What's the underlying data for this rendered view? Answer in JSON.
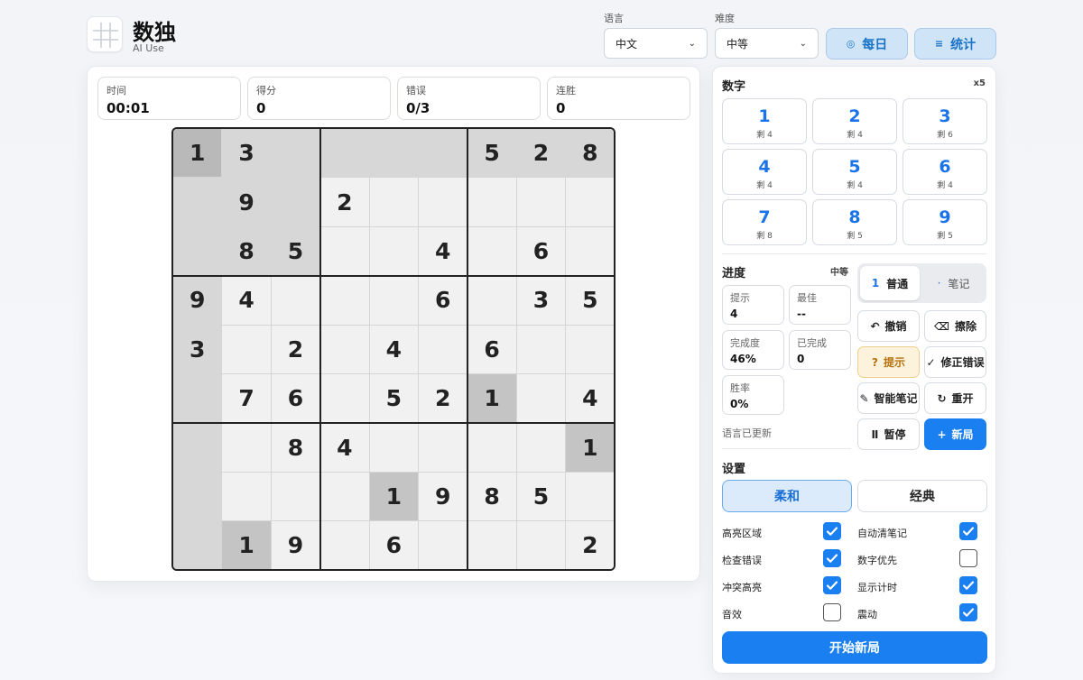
{
  "header": {
    "title": "数独",
    "subtitle": "AI Use",
    "logo_icon": "grid-logo-icon"
  },
  "controls": {
    "language": {
      "label": "语言",
      "value": "中文"
    },
    "difficulty": {
      "label": "难度",
      "value": "中等"
    },
    "daily_label": "每日",
    "daily_icon": "target-icon",
    "stats_label": "统计",
    "stats_icon": "menu-icon"
  },
  "stats": [
    {
      "label": "时间",
      "value": "00:01"
    },
    {
      "label": "得分",
      "value": "0"
    },
    {
      "label": "错误",
      "value": "0/3"
    },
    {
      "label": "连胜",
      "value": "0"
    }
  ],
  "board": {
    "rows": [
      [
        "1",
        "3",
        "",
        "",
        "",
        "",
        "5",
        "2",
        "8"
      ],
      [
        "",
        "9",
        "",
        "2",
        "",
        "",
        "",
        "",
        ""
      ],
      [
        "",
        "8",
        "5",
        "",
        "",
        "4",
        "",
        "6",
        ""
      ],
      [
        "9",
        "4",
        "",
        "",
        "",
        "6",
        "",
        "3",
        "5"
      ],
      [
        "3",
        "",
        "2",
        "",
        "4",
        "",
        "6",
        "",
        ""
      ],
      [
        "",
        "7",
        "6",
        "",
        "5",
        "2",
        "1",
        "",
        "4"
      ],
      [
        "",
        "",
        "8",
        "4",
        "",
        "",
        "",
        "",
        "1"
      ],
      [
        "",
        "",
        "",
        "",
        "1",
        "9",
        "8",
        "5",
        ""
      ],
      [
        "",
        "1",
        "9",
        "",
        "6",
        "",
        "",
        "",
        "2"
      ]
    ],
    "selected": [
      0,
      0
    ],
    "same_number_cells": [
      [
        5,
        6
      ],
      [
        6,
        8
      ],
      [
        7,
        4
      ],
      [
        8,
        1
      ]
    ],
    "colors": {
      "normal": "#f1f1f1",
      "region": "#d7d7d7",
      "selected": "#b9b9b9",
      "same_number": "#c4c4c4"
    }
  },
  "numbers": {
    "title": "数字",
    "multiplier": "x5",
    "items": [
      {
        "digit": "1",
        "remain": "剩 4"
      },
      {
        "digit": "2",
        "remain": "剩 4"
      },
      {
        "digit": "3",
        "remain": "剩 6"
      },
      {
        "digit": "4",
        "remain": "剩 4"
      },
      {
        "digit": "5",
        "remain": "剩 4"
      },
      {
        "digit": "6",
        "remain": "剩 4"
      },
      {
        "digit": "7",
        "remain": "剩 8"
      },
      {
        "digit": "8",
        "remain": "剩 5"
      },
      {
        "digit": "9",
        "remain": "剩 5"
      }
    ]
  },
  "progress": {
    "title": "进度",
    "difficulty": "中等",
    "boxes": [
      {
        "label": "提示",
        "value": "4"
      },
      {
        "label": "最佳",
        "value": "--"
      },
      {
        "label": "完成度",
        "value": "46%"
      },
      {
        "label": "已完成",
        "value": "0"
      },
      {
        "label": "胜率",
        "value": "0%"
      }
    ],
    "status": "语言已更新"
  },
  "mode": {
    "normal_num": "1",
    "normal_label": "普通",
    "notes_dot": "·",
    "notes_label": "笔记"
  },
  "actions": {
    "undo": "撤销",
    "erase": "擦除",
    "hint": "提示",
    "fix": "修正错误",
    "smart_notes": "智能笔记",
    "restart": "重开",
    "pause": "暂停",
    "new_game": "新局"
  },
  "settings": {
    "title": "设置",
    "theme_soft": "柔和",
    "theme_classic": "经典",
    "options": [
      {
        "label": "高亮区域",
        "checked": true
      },
      {
        "label": "自动清笔记",
        "checked": true
      },
      {
        "label": "检查错误",
        "checked": true
      },
      {
        "label": "数字优先",
        "checked": false
      },
      {
        "label": "冲突高亮",
        "checked": true
      },
      {
        "label": "显示计时",
        "checked": true
      },
      {
        "label": "音效",
        "checked": false
      },
      {
        "label": "震动",
        "checked": true
      }
    ],
    "start_label": "开始新局"
  }
}
